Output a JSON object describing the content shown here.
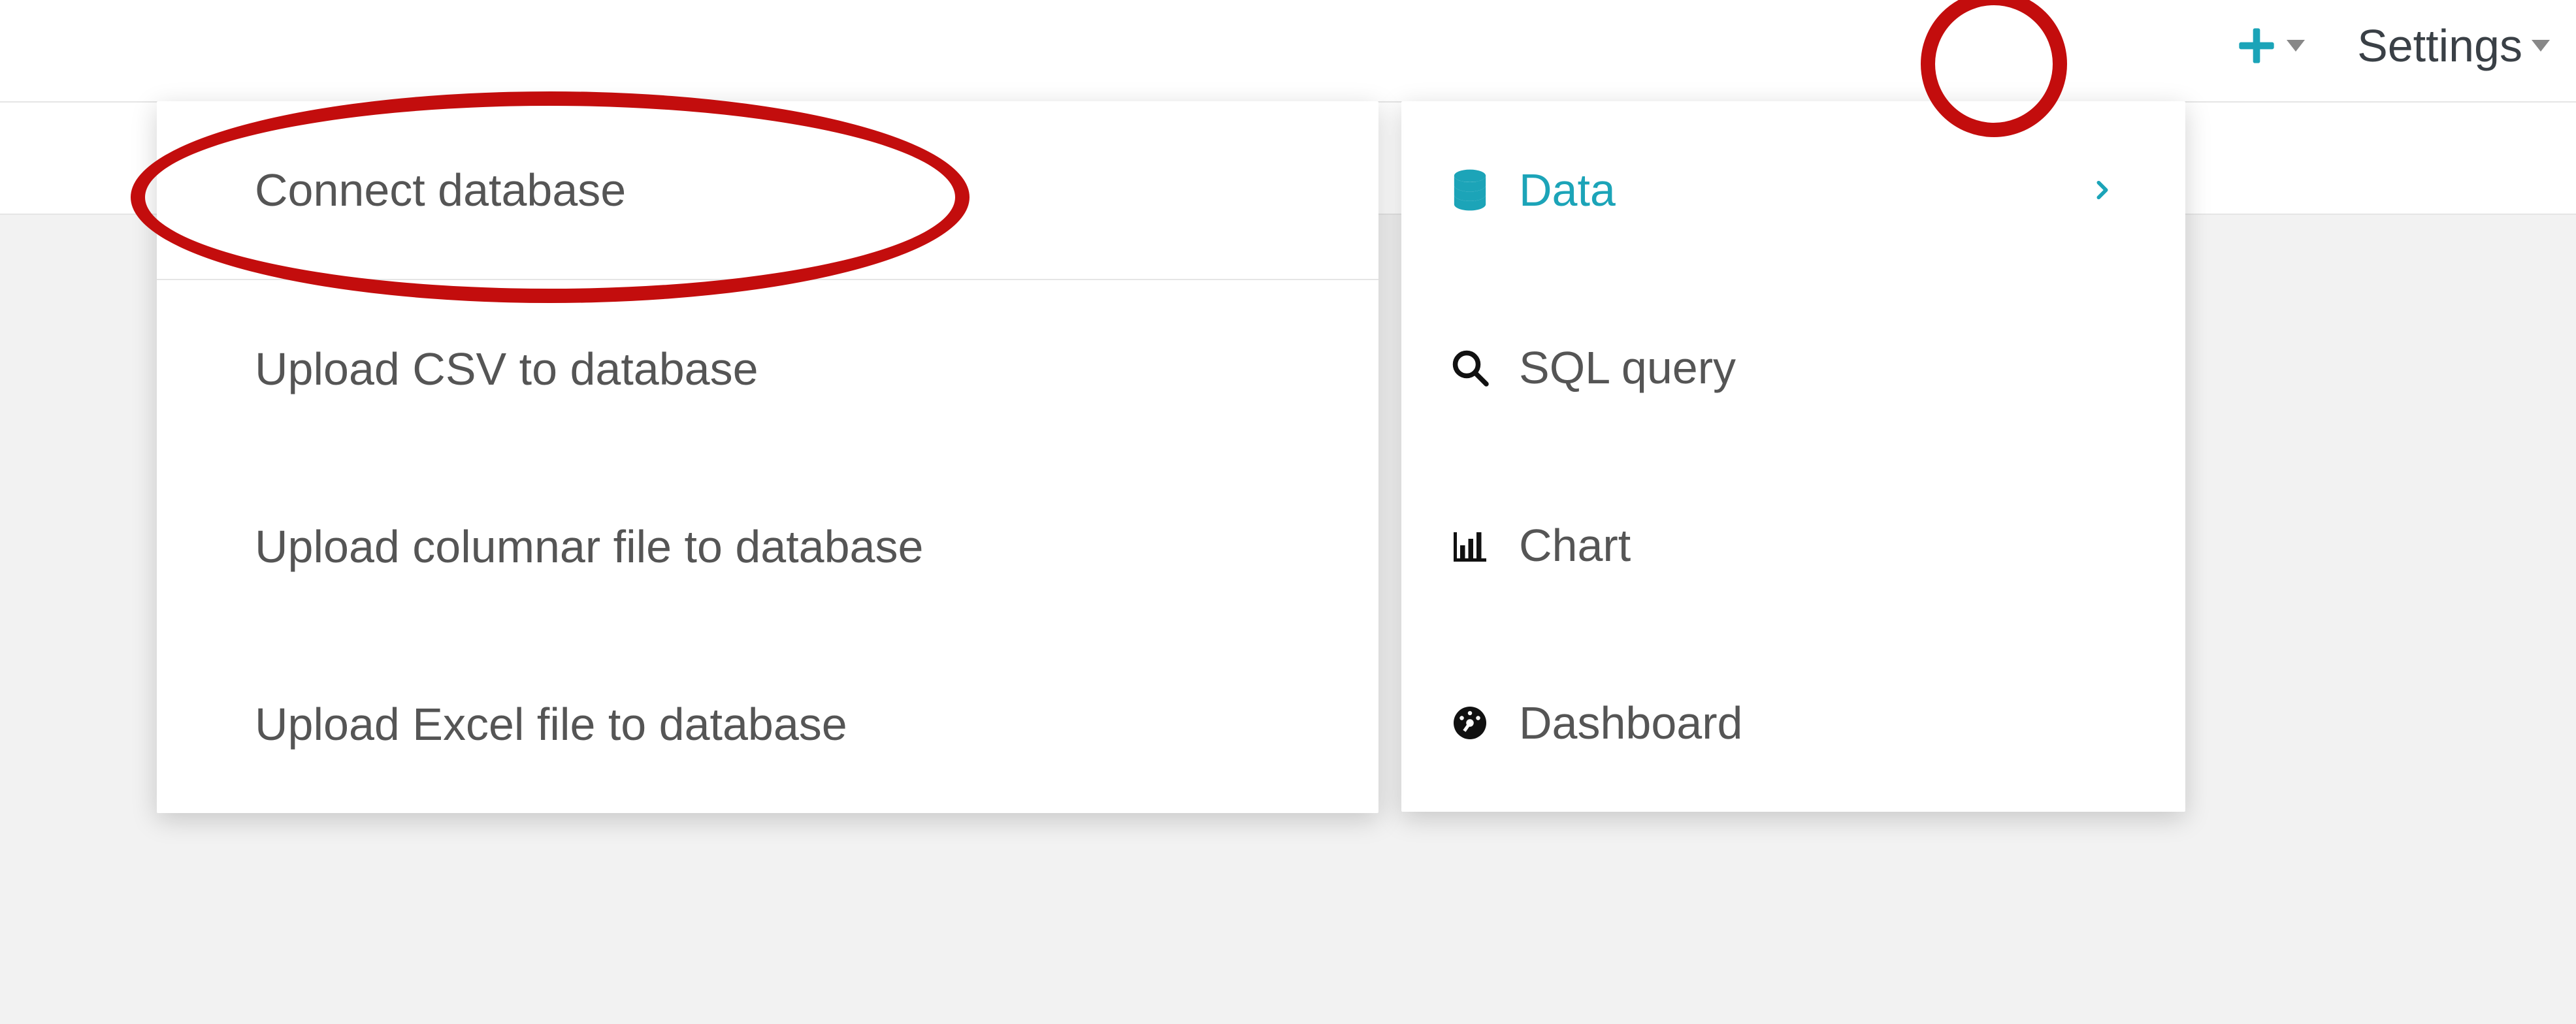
{
  "topbar": {
    "settings_label": "Settings"
  },
  "add_menu": {
    "items": [
      {
        "label": "Data",
        "icon": "database-icon",
        "active": true,
        "chevron": true
      },
      {
        "label": "SQL query",
        "icon": "search-icon",
        "active": false
      },
      {
        "label": "Chart",
        "icon": "bar-chart-icon",
        "active": false
      },
      {
        "label": "Dashboard",
        "icon": "gauge-icon",
        "active": false
      }
    ]
  },
  "data_submenu": {
    "items": [
      {
        "label": "Connect database"
      },
      {
        "label": "Upload CSV to database"
      },
      {
        "label": "Upload columnar file to database"
      },
      {
        "label": "Upload Excel file to database"
      }
    ]
  },
  "colors": {
    "accent": "#1ca4b8"
  }
}
